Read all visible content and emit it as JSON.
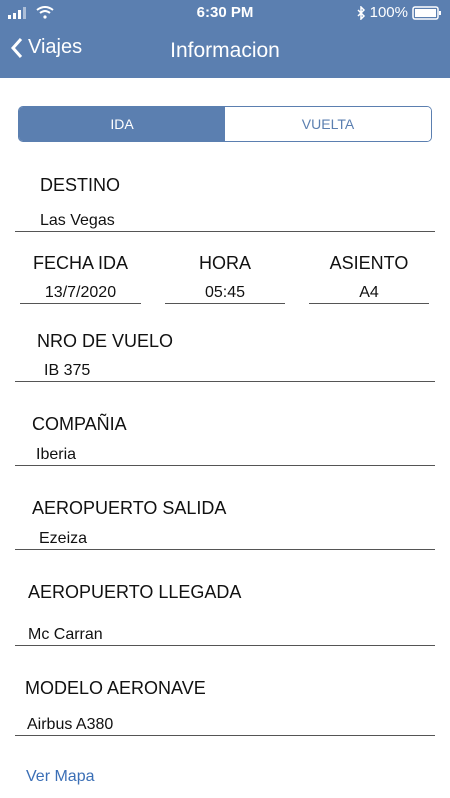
{
  "status": {
    "time": "6:30 PM",
    "battery": "100%"
  },
  "nav": {
    "back": "Viajes",
    "title": "Informacion"
  },
  "segment": {
    "ida": "IDA",
    "vuelta": "VUELTA"
  },
  "destino": {
    "label": "DESTINO",
    "value": "Las Vegas"
  },
  "fecha": {
    "label": "FECHA IDA",
    "value": "13/7/2020"
  },
  "hora": {
    "label": "HORA",
    "value": "05:45"
  },
  "asiento": {
    "label": "ASIENTO",
    "value": "A4"
  },
  "vuelo": {
    "label": "NRO DE VUELO",
    "value": "IB 375"
  },
  "compania": {
    "label": "COMPAÑIA",
    "value": "Iberia"
  },
  "salida": {
    "label": "AEROPUERTO SALIDA",
    "value": "Ezeiza"
  },
  "llegada": {
    "label": "AEROPUERTO LLEGADA",
    "value": "Mc Carran"
  },
  "modelo": {
    "label": "MODELO AERONAVE",
    "value": "Airbus A380"
  },
  "link": "Ver Mapa"
}
